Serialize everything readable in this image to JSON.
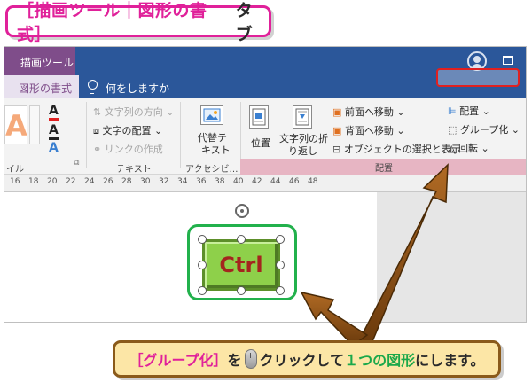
{
  "title": {
    "bracketed": "［描画ツール｜図形の書式］",
    "suffix": "タブ"
  },
  "window": {
    "context_label": "描画ツール"
  },
  "tabs": {
    "active": "図形の書式",
    "tell_me": "何をしますか"
  },
  "ribbon": {
    "wordart_group_label": "イル",
    "text_group": {
      "direction": "文字列の方向",
      "align": "文字の配置",
      "link": "リンクの作成",
      "label": "テキスト"
    },
    "accessibility": {
      "alt_text_line1": "代替テ",
      "alt_text_line2": "キスト",
      "label": "アクセシビ…"
    },
    "arrange": {
      "position": "位置",
      "wrap_line1": "文字列の折",
      "wrap_line2": "り返し",
      "bring_forward": "前面へ移動",
      "send_backward": "背面へ移動",
      "selection_pane": "オブジェクトの選択と表示",
      "align": "配置",
      "group": "グループ化",
      "rotate": "回転",
      "label": "配置"
    }
  },
  "ruler": {
    "ticks": [
      "16",
      "18",
      "20",
      "22",
      "24",
      "26",
      "28",
      "30",
      "32",
      "34",
      "36",
      "38",
      "40",
      "42",
      "44",
      "46",
      "48"
    ]
  },
  "shape": {
    "text": "Ctrl"
  },
  "callout": {
    "part1": "［グループ化］",
    "part2": "を",
    "part3": "クリックして",
    "part4": "１つの図形",
    "part5": "にします。"
  },
  "colors": {
    "title_pink": "#e0219a",
    "ribbon_blue": "#2b579a",
    "context_purple": "#7f4d8a",
    "arrow_brown": "#7a4310",
    "highlight_red": "#e02020"
  }
}
